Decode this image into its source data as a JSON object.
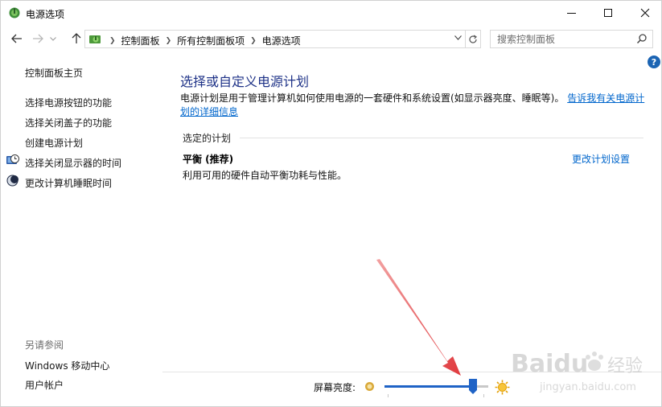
{
  "window": {
    "title": "电源选项"
  },
  "nav": {
    "back_icon": "arrow-left-icon",
    "forward_icon": "arrow-right-icon",
    "up_icon": "arrow-up-icon",
    "refresh_icon": "refresh-icon"
  },
  "address": {
    "crumbs": [
      "控制面板",
      "所有控制面板项",
      "电源选项"
    ]
  },
  "search": {
    "placeholder": "搜索控制面板"
  },
  "help": {
    "label": "?"
  },
  "sidebar": {
    "home": "控制面板主页",
    "items": [
      {
        "label": "选择电源按钮的功能"
      },
      {
        "label": "选择关闭盖子的功能"
      },
      {
        "label": "创建电源计划"
      },
      {
        "label": "选择关闭显示器的时间",
        "icon": "display-clock-icon"
      },
      {
        "label": "更改计算机睡眠时间",
        "icon": "moon-icon"
      }
    ],
    "see_also_label": "另请参阅",
    "see_also": [
      {
        "label": "Windows 移动中心"
      },
      {
        "label": "用户帐户"
      }
    ]
  },
  "main": {
    "title": "选择或自定义电源计划",
    "description": "电源计划是用于管理计算机如何使用电源的一套硬件和系统设置(如显示器亮度、睡眠等)。",
    "description_link": "告诉我有关电源计划的详细信息",
    "section_label": "选定的计划",
    "plan_name": "平衡 (推荐)",
    "plan_description": "利用可用的硬件自动平衡功耗与性能。",
    "plan_change": "更改计划设置"
  },
  "brightness": {
    "label": "屏幕亮度:",
    "level_percent": 85
  },
  "watermark": {
    "brand": "Baidu",
    "brand_cn": "经验",
    "url": "jingyan.baidu.com"
  },
  "colors": {
    "accent_link": "#0066cc",
    "title_blue": "#1e3287",
    "annotation_arrow": "#e03a3e",
    "slider_blue": "#1f63c6"
  }
}
